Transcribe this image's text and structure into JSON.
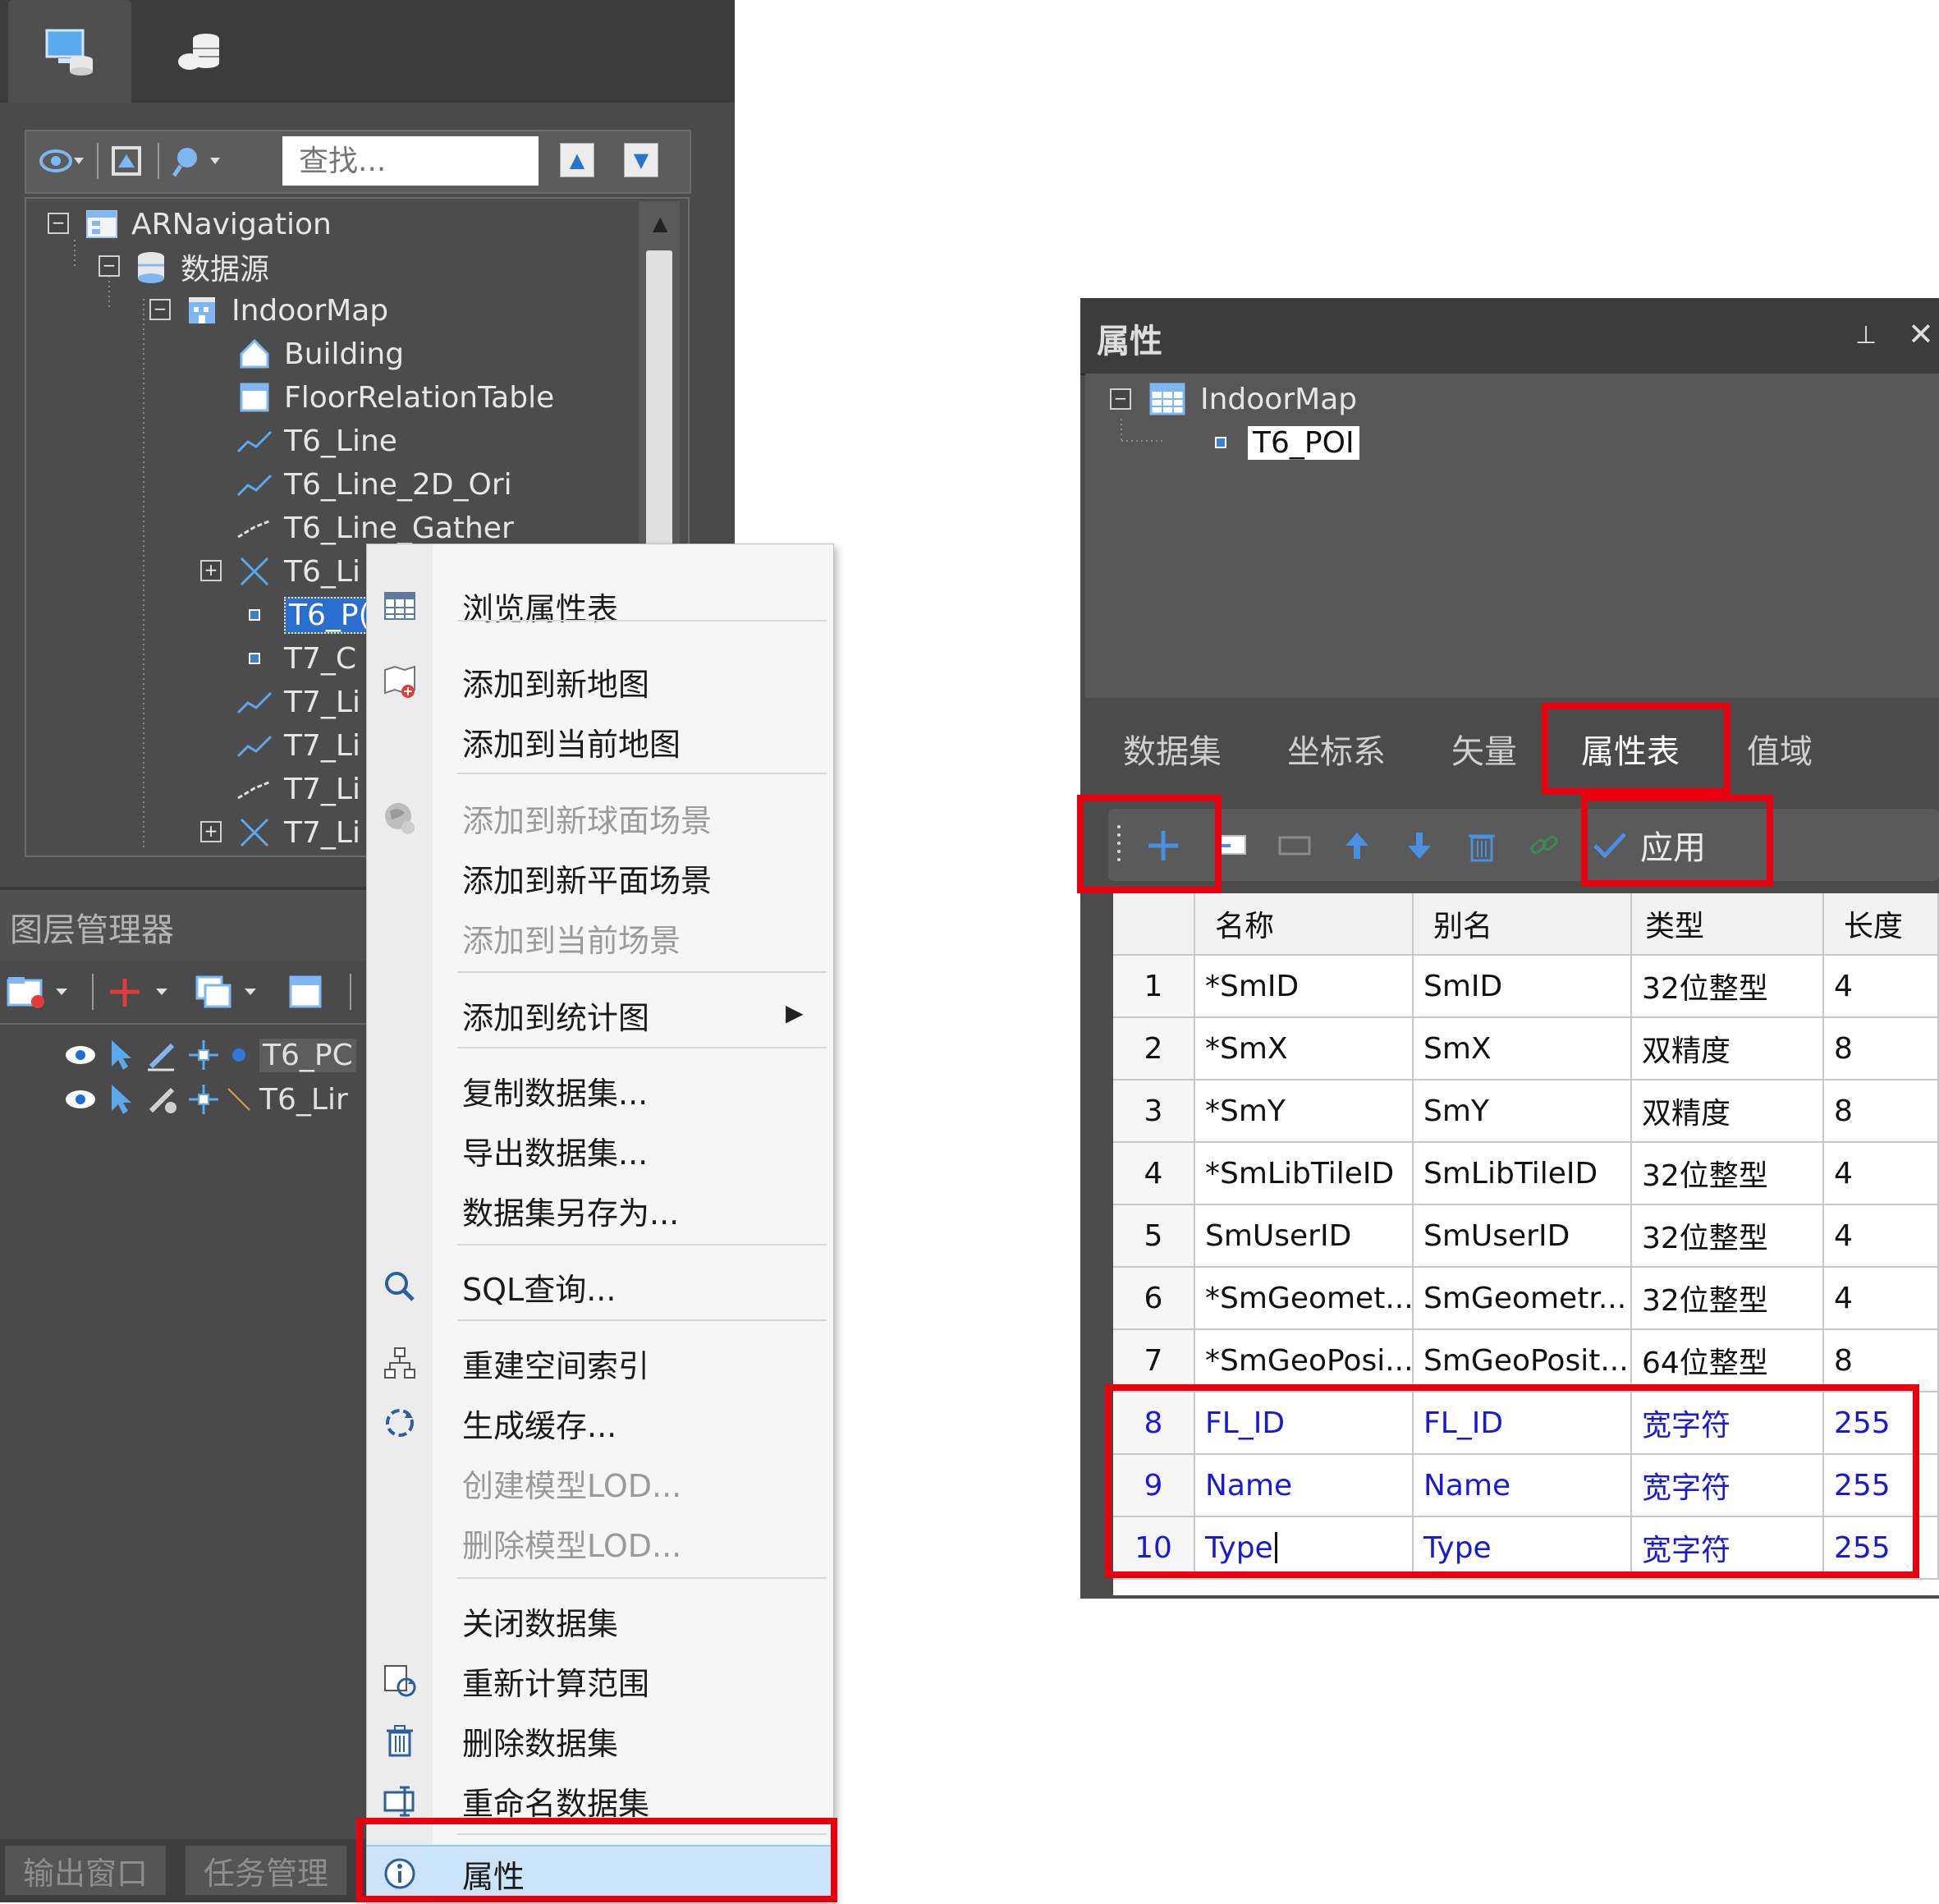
{
  "workspace": {
    "search_placeholder": "查找...",
    "tree": [
      {
        "label": "ARNavigation"
      },
      {
        "label": "数据源"
      },
      {
        "label": "IndoorMap"
      },
      {
        "label": "Building"
      },
      {
        "label": "FloorRelationTable"
      },
      {
        "label": "T6_Line"
      },
      {
        "label": "T6_Line_2D_Ori"
      },
      {
        "label": "T6_Line_Gather"
      },
      {
        "label": "T6_Li"
      },
      {
        "label": "T6_P("
      },
      {
        "label": "T7_C"
      },
      {
        "label": "T7_Li"
      },
      {
        "label": "T7_Li"
      },
      {
        "label": "T7_Li"
      },
      {
        "label": "T7_Li"
      }
    ]
  },
  "layer_manager": {
    "title": "图层管理器",
    "layers": [
      {
        "label": "T6_PC"
      },
      {
        "label": "T6_Lir"
      }
    ]
  },
  "bottom_tabs": [
    "输出窗口",
    "任务管理"
  ],
  "context_menu": {
    "items": [
      {
        "label": "浏览属性表",
        "icon": "table-icon"
      },
      {
        "label": "添加到新地图",
        "icon": "add-map-icon"
      },
      {
        "label": "添加到当前地图"
      },
      {
        "label": "添加到新球面场景",
        "icon": "globe-icon"
      },
      {
        "label": "添加到新平面场景"
      },
      {
        "label": "添加到当前场景"
      },
      {
        "label": "添加到统计图"
      },
      {
        "label": "复制数据集..."
      },
      {
        "label": "导出数据集..."
      },
      {
        "label": "数据集另存为..."
      },
      {
        "label": "SQL查询...",
        "icon": "search-icon"
      },
      {
        "label": "重建空间索引",
        "icon": "index-icon"
      },
      {
        "label": "生成缓存...",
        "icon": "cache-icon"
      },
      {
        "label": "创建模型LOD..."
      },
      {
        "label": "删除模型LOD..."
      },
      {
        "label": "关闭数据集"
      },
      {
        "label": "重新计算范围",
        "icon": "recalc-icon"
      },
      {
        "label": "删除数据集",
        "icon": "trash-icon"
      },
      {
        "label": "重命名数据集",
        "icon": "rename-icon"
      },
      {
        "label": "属性",
        "icon": "info-icon"
      }
    ]
  },
  "properties": {
    "title": "属性",
    "tree_root": "IndoorMap",
    "tree_child": "T6_POI",
    "tabs": [
      "数据集",
      "坐标系",
      "矢量",
      "属性表",
      "值域"
    ],
    "active_tab": "属性表",
    "apply_label": "应用",
    "columns": [
      "名称",
      "别名",
      "类型",
      "长度"
    ],
    "rows": [
      {
        "n": "1",
        "name": "*SmID",
        "alias": "SmID",
        "type": "32位整型",
        "len": "4"
      },
      {
        "n": "2",
        "name": "*SmX",
        "alias": "SmX",
        "type": "双精度",
        "len": "8"
      },
      {
        "n": "3",
        "name": "*SmY",
        "alias": "SmY",
        "type": "双精度",
        "len": "8"
      },
      {
        "n": "4",
        "name": "*SmLibTileID",
        "alias": "SmLibTileID",
        "type": "32位整型",
        "len": "4"
      },
      {
        "n": "5",
        "name": "SmUserID",
        "alias": "SmUserID",
        "type": "32位整型",
        "len": "4"
      },
      {
        "n": "6",
        "name": "*SmGeomet...",
        "alias": "SmGeometr...",
        "type": "32位整型",
        "len": "4"
      },
      {
        "n": "7",
        "name": "*SmGeoPosi...",
        "alias": "SmGeoPosit...",
        "type": "64位整型",
        "len": "8"
      },
      {
        "n": "8",
        "name": "FL_ID",
        "alias": "FL_ID",
        "type": "宽字符",
        "len": "255"
      },
      {
        "n": "9",
        "name": "Name",
        "alias": "Name",
        "type": "宽字符",
        "len": "255"
      },
      {
        "n": "10",
        "name": "Type",
        "alias": "Type",
        "type": "宽字符",
        "len": "255"
      }
    ]
  },
  "colors": {
    "highlight": "#e8000f",
    "new_field_text": "#1a1ad6",
    "menu_selected": "#cce4f7"
  }
}
